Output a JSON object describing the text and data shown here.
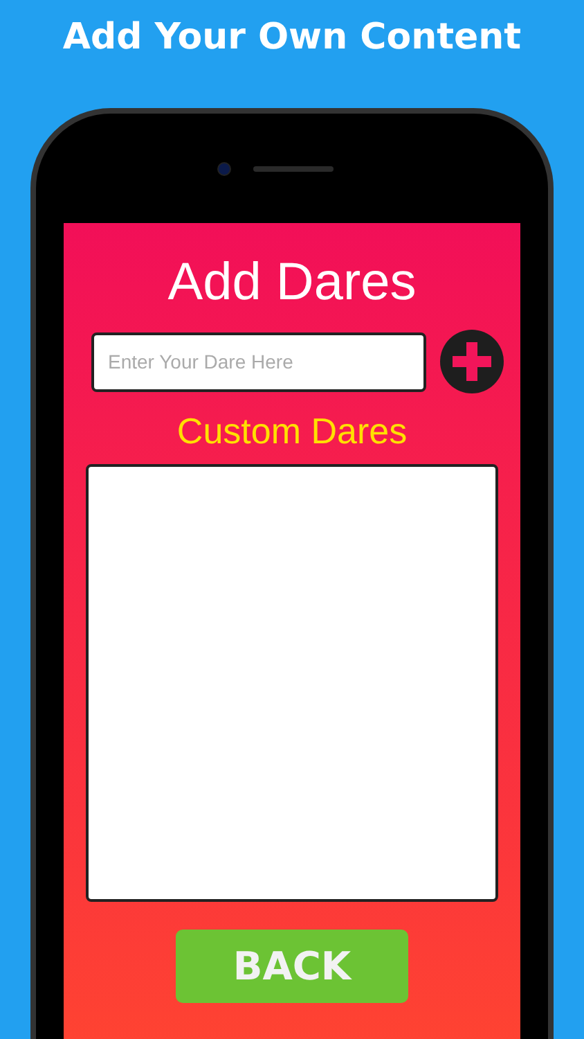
{
  "headline": "Add Your Own Content",
  "screen": {
    "title": "Add Dares",
    "dare_field": {
      "placeholder": "Enter Your Dare Here"
    },
    "section_title": "Custom Dares",
    "back_button": "BACK"
  }
}
